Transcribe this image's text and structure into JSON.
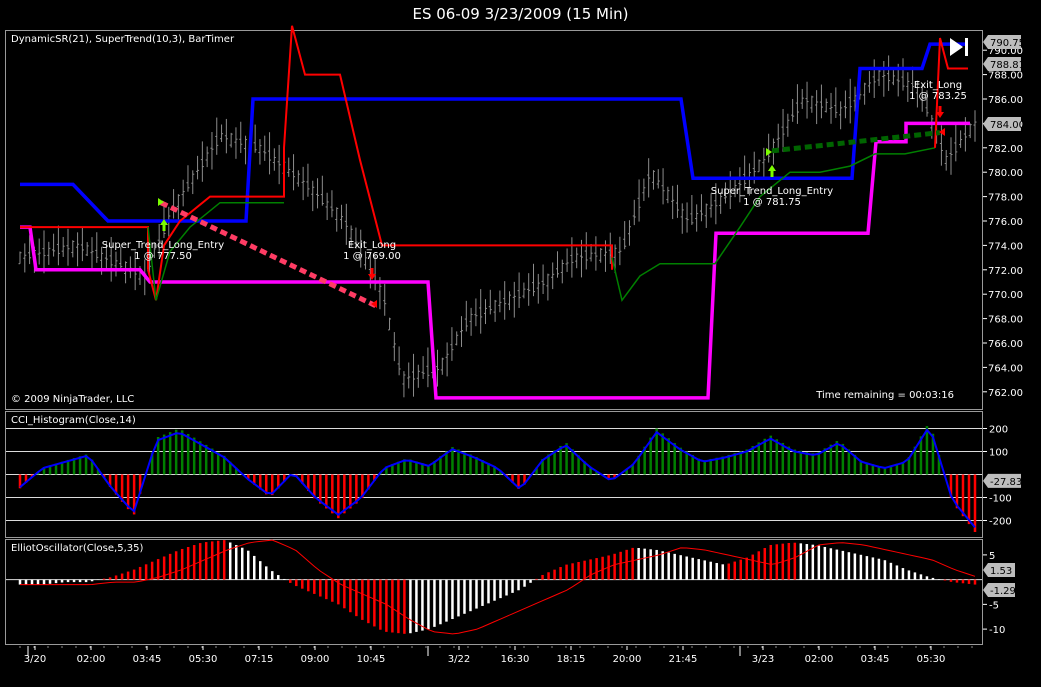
{
  "window": {
    "title": "ES 06-09  3/23/2009 (15 Min)"
  },
  "panel1": {
    "label": "DynamicSR(21), SuperTrend(10,3), BarTimer",
    "copyright": "© 2009 NinjaTrader, LLC",
    "time_remaining": "Time remaining = 00:03:16",
    "axis_ticks": [
      "790.00",
      "788.00",
      "786.00",
      "784.00",
      "782.00",
      "780.00",
      "778.00",
      "776.00",
      "774.00",
      "772.00",
      "770.00",
      "768.00",
      "766.00",
      "764.00",
      "762.00"
    ],
    "price_tags": [
      "790.75",
      "788.81",
      "784.00"
    ],
    "annotations": [
      {
        "line1": "Super_Trend_Long_Entry",
        "line2": "1 @ 777.50"
      },
      {
        "line1": "Exit_Long",
        "line2": "1 @ 769.00"
      },
      {
        "line1": "Super_Trend_Long_Entry",
        "line2": "1 @ 781.75"
      },
      {
        "line1": "Exit_Long",
        "line2": "1 @ 783.25"
      }
    ]
  },
  "panel2": {
    "label": "CCI_Histogram(Close,14)",
    "axis_ticks": [
      "200",
      "100",
      "-100",
      "-200"
    ],
    "value_tag": "-27.83"
  },
  "panel3": {
    "label": "ElliotOscillator(Close,5,35)",
    "axis_ticks": [
      "5",
      "-5",
      "-10"
    ],
    "value_tags": [
      "1.53",
      "-1.29"
    ]
  },
  "xaxis": {
    "ticks": [
      "3/20",
      "02:00",
      "03:45",
      "05:30",
      "07:15",
      "09:00",
      "10:45",
      "3/22",
      "16:30",
      "18:15",
      "20:00",
      "21:45",
      "3/23",
      "02:00",
      "03:45",
      "05:30"
    ]
  },
  "colors": {
    "background": "#000000",
    "dynamic_sr_resistance": "#0000ff",
    "dynamic_sr_support": "#ff00ff",
    "supertrend_down": "#ff0000",
    "supertrend_up": "#008000",
    "cci_positive": "#008000",
    "cci_negative": "#ff0000",
    "cci_line": "#0000ff",
    "elliot_positive": "#ff0000",
    "elliot_negative": "#ffffff",
    "trade_loss": "#ff3c64",
    "trade_win": "#006400",
    "entry_arrow": "#7cfc00",
    "exit_arrow": "#ff0000"
  },
  "chart_data": [
    {
      "type": "line",
      "title": "ES 06-09  3/23/2009 (15 Min)",
      "panel": "DynamicSR(21), SuperTrend(10,3), BarTimer",
      "ylim": [
        761,
        791
      ],
      "series": [
        {
          "name": "DynamicSR(21)",
          "values": [
            779,
            779,
            779,
            775.5,
            775.5,
            775.5,
            775.5,
            775.5,
            775.5,
            786,
            786,
            786,
            786,
            786,
            786,
            786,
            786,
            786,
            786,
            786,
            786,
            786,
            786,
            786,
            779.5,
            779.5,
            779.5,
            779.5,
            779.5,
            779.5,
            779.5,
            779.5,
            779.5,
            779.5,
            788.5,
            788.5,
            788.5,
            790.5,
            790.5
          ]
        },
        {
          "name": "SuperTrend(10,3)",
          "values": [
            775.5,
            775.5,
            775.5,
            775.5,
            775.5,
            775.5,
            771,
            776,
            778,
            778,
            790,
            788,
            788,
            788,
            782,
            774,
            774,
            774,
            774,
            774,
            774,
            774,
            774,
            774,
            770,
            772,
            772,
            772,
            772,
            772,
            772,
            772,
            773,
            778,
            780,
            782,
            782.5,
            784,
            784
          ]
        }
      ]
    },
    {
      "type": "bar",
      "panel": "CCI_Histogram(Close,14)",
      "ylim": [
        -250,
        250
      ],
      "values": [
        -60,
        30,
        60,
        90,
        -60,
        -180,
        160,
        200,
        140,
        80,
        -20,
        -100,
        10,
        -110,
        -190,
        -110,
        30,
        70,
        40,
        120,
        80,
        30,
        -70,
        70,
        140,
        40,
        -30,
        50,
        200,
        120,
        60,
        80,
        110,
        170,
        110,
        90,
        150,
        60,
        30,
        60,
        230,
        -120,
        -250
      ]
    },
    {
      "type": "bar",
      "panel": "ElliotOscillator(Close,5,35)",
      "ylim": [
        -12,
        7
      ],
      "values": [
        -1,
        -1,
        -0.5,
        -0.5,
        0.5,
        2,
        4,
        6,
        7.5,
        8,
        6,
        2,
        -1,
        -3,
        -5,
        -8,
        -10.5,
        -11,
        -10,
        -8,
        -6,
        -4,
        -2,
        1,
        3,
        4,
        5,
        6.5,
        6,
        5,
        4,
        3,
        4.5,
        7,
        7.5,
        7,
        6,
        5,
        4,
        2,
        0.5,
        -0.5,
        -1
      ]
    }
  ]
}
